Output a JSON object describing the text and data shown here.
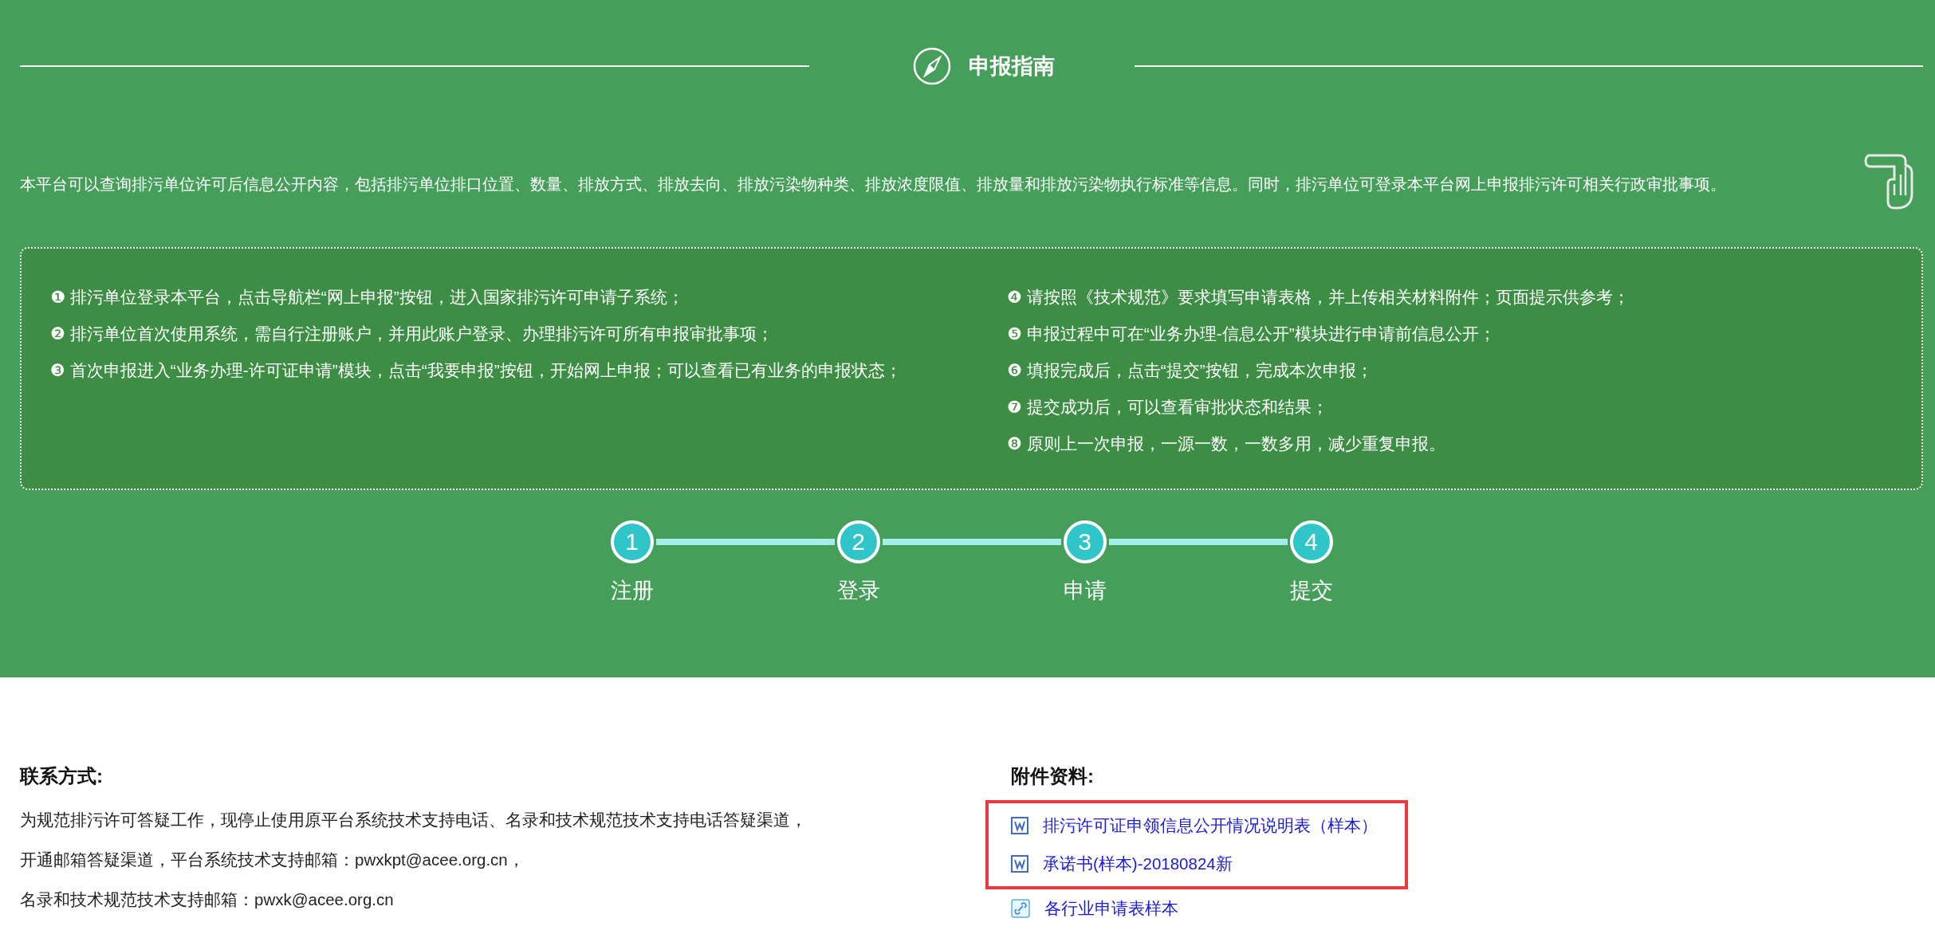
{
  "guide": {
    "title": "申报指南",
    "intro": "本平台可以查询排污单位许可后信息公开内容，包括排污单位排口位置、数量、排放方式、排放去向、排放污染物种类、排放浓度限值、排放量和排放污染物执行标准等信息。同时，排污单位可登录本平台网上申报排污许可相关行政审批事项。",
    "steps_left": [
      "❶ 排污单位登录本平台，点击导航栏“网上申报”按钮，进入国家排污许可申请子系统；",
      "❷ 排污单位首次使用系统，需自行注册账户，并用此账户登录、办理排污许可所有申报审批事项；",
      "❸ 首次申报进入“业务办理-许可证申请”模块，点击“我要申报”按钮，开始网上申报；可以查看已有业务的申报状态；"
    ],
    "steps_right": [
      "❹ 请按照《技术规范》要求填写申请表格，并上传相关材料附件；页面提示供参考；",
      "❺ 申报过程中可在“业务办理-信息公开”模块进行申请前信息公开；",
      "❻ 填报完成后，点击“提交”按钮，完成本次申报；",
      "❼ 提交成功后，可以查看审批状态和结果；",
      "❽ 原则上一次申报，一源一数，一数多用，减少重复申报。"
    ],
    "progress": [
      {
        "number": "1",
        "label": "注册"
      },
      {
        "number": "2",
        "label": "登录"
      },
      {
        "number": "3",
        "label": "申请"
      },
      {
        "number": "4",
        "label": "提交"
      }
    ]
  },
  "contact": {
    "title": "联系方式:",
    "lines": [
      "为规范排污许可答疑工作，现停止使用原平台系统技术支持电话、名录和技术规范技术支持电话答疑渠道，",
      "开通邮箱答疑渠道，平台系统技术支持邮箱：pwxkpt@acee.org.cn，",
      "名录和技术规范技术支持邮箱：pwxk@acee.org.cn"
    ]
  },
  "attachments": {
    "title": "附件资料:",
    "links": [
      {
        "kind": "word",
        "label": "排污许可证申领信息公开情况说明表（样本）",
        "highlighted": true
      },
      {
        "kind": "word",
        "label": "承诺书(样本)-20180824新",
        "highlighted": true
      },
      {
        "kind": "link",
        "label": "各行业申请表样本",
        "highlighted": false
      }
    ]
  }
}
